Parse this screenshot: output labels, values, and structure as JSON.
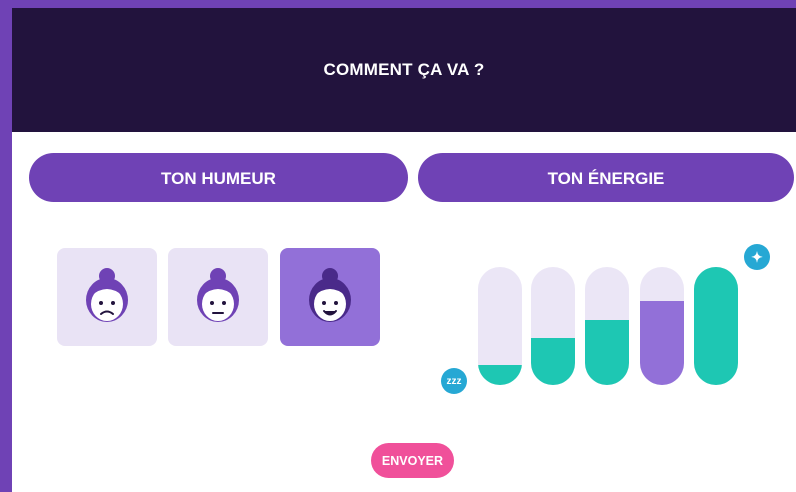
{
  "header": {
    "title": "COMMENT ÇA VA ?"
  },
  "tabs": [
    {
      "label": "TON HUMEUR"
    },
    {
      "label": "TON ÉNERGIE"
    }
  ],
  "mood": {
    "options": [
      {
        "icon": "sad-face-icon",
        "selected": false
      },
      {
        "icon": "neutral-face-icon",
        "selected": false
      },
      {
        "icon": "happy-face-icon",
        "selected": true
      }
    ]
  },
  "energy": {
    "low_icon": "zzz",
    "high_icon": "✦",
    "bars": [
      {
        "level": 0.17,
        "color": "#1ec7b3"
      },
      {
        "level": 0.4,
        "color": "#1ec7b3"
      },
      {
        "level": 0.55,
        "color": "#1ec7b3"
      },
      {
        "level": 0.71,
        "color": "#9270d8"
      },
      {
        "level": 1.0,
        "color": "#1ec7b3"
      }
    ]
  },
  "submit": {
    "label": "ENVOYER"
  },
  "colors": {
    "accent": "#6f42b5",
    "header_bg": "#22133d",
    "teal": "#1ec7b3",
    "purple_light": "#9270d8",
    "pink": "#f0509a"
  }
}
